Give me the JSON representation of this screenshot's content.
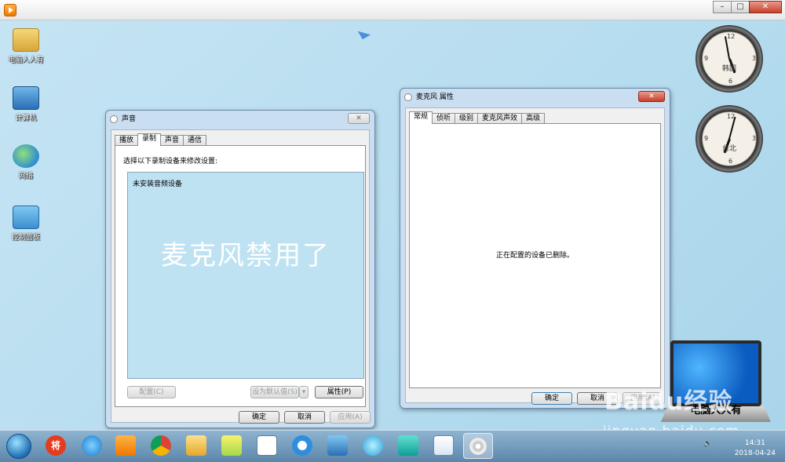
{
  "outer": {
    "controls": [
      "–",
      "□",
      "✕"
    ]
  },
  "desktop": {
    "icons": [
      {
        "label": "电脑人人有"
      },
      {
        "label": "计算机"
      },
      {
        "label": "网络"
      },
      {
        "label": "控制面板"
      }
    ],
    "clocks": [
      {
        "city": "韩国"
      },
      {
        "city": "台北"
      }
    ]
  },
  "sound_dialog": {
    "title": "声音",
    "close": "✕",
    "tabs": [
      "播放",
      "录制",
      "声音",
      "通信"
    ],
    "instruction": "选择以下录制设备来修改设置:",
    "empty_text": "未安装音频设备",
    "overlay": "麦克风禁用了",
    "configure": "配置(C)",
    "set_default": "设为默认值(S)",
    "properties": "属性(P)",
    "ok": "确定",
    "cancel": "取消",
    "apply": "应用(A)"
  },
  "mic_dialog": {
    "title": "麦克风 属性",
    "close": "✕",
    "tabs": [
      "常规",
      "侦听",
      "级别",
      "麦克风声效",
      "高级"
    ],
    "message": "正在配置的设备已删除。",
    "ok": "确定",
    "cancel": "取消",
    "apply": "应用(A)"
  },
  "laptop": {
    "caption": "电脑人人有"
  },
  "watermark": {
    "brand": "Baidu经验",
    "url": "jingyan.baidu.com"
  },
  "taskbar": {
    "apps": [
      "将",
      "IE",
      "播放器",
      "Chrome",
      "文件夹",
      "便签",
      "文档",
      "浏览器",
      "远程",
      "刷新",
      "耳机",
      "画图",
      "光盘"
    ],
    "time": "14:31",
    "date": "2018-04-24"
  }
}
